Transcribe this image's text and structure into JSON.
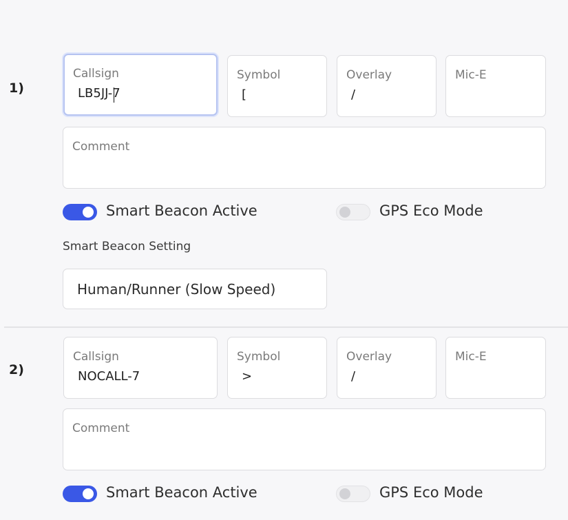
{
  "beacons": [
    {
      "index": "1)",
      "callsign": {
        "label": "Callsign",
        "value": "LB5JJ-7"
      },
      "symbol": {
        "label": "Symbol",
        "value": "["
      },
      "overlay": {
        "label": "Overlay",
        "value": "/"
      },
      "mic_e": {
        "label": "Mic-E",
        "value": ""
      },
      "comment": {
        "label": "Comment",
        "value": ""
      },
      "smart_beacon": {
        "label": "Smart Beacon Active",
        "on": true
      },
      "gps_eco": {
        "label": "GPS Eco Mode",
        "on": false
      },
      "smart_beacon_setting": {
        "label": "Smart Beacon Setting",
        "value": "Human/Runner (Slow Speed)"
      }
    },
    {
      "index": "2)",
      "callsign": {
        "label": "Callsign",
        "value": "NOCALL-7"
      },
      "symbol": {
        "label": "Symbol",
        "value": ">"
      },
      "overlay": {
        "label": "Overlay",
        "value": "/"
      },
      "mic_e": {
        "label": "Mic-E",
        "value": ""
      },
      "comment": {
        "label": "Comment",
        "value": ""
      },
      "smart_beacon": {
        "label": "Smart Beacon Active",
        "on": true
      },
      "gps_eco": {
        "label": "GPS Eco Mode",
        "on": false
      }
    }
  ],
  "colors": {
    "accent": "#3a58e6",
    "focus_border": "#b5c3f1",
    "background": "#f7f7f9"
  }
}
